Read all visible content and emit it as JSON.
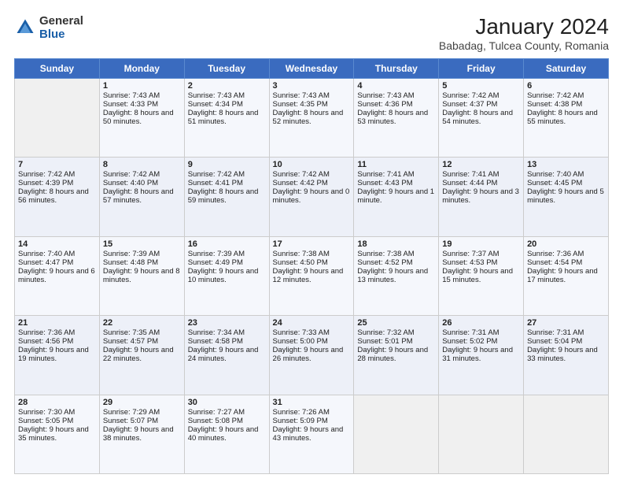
{
  "header": {
    "logo": {
      "general": "General",
      "blue": "Blue"
    },
    "title": "January 2024",
    "subtitle": "Babadag, Tulcea County, Romania"
  },
  "days_of_week": [
    "Sunday",
    "Monday",
    "Tuesday",
    "Wednesday",
    "Thursday",
    "Friday",
    "Saturday"
  ],
  "weeks": [
    [
      {
        "day": "",
        "sunrise": "",
        "sunset": "",
        "daylight": ""
      },
      {
        "day": "1",
        "sunrise": "Sunrise: 7:43 AM",
        "sunset": "Sunset: 4:33 PM",
        "daylight": "Daylight: 8 hours and 50 minutes."
      },
      {
        "day": "2",
        "sunrise": "Sunrise: 7:43 AM",
        "sunset": "Sunset: 4:34 PM",
        "daylight": "Daylight: 8 hours and 51 minutes."
      },
      {
        "day": "3",
        "sunrise": "Sunrise: 7:43 AM",
        "sunset": "Sunset: 4:35 PM",
        "daylight": "Daylight: 8 hours and 52 minutes."
      },
      {
        "day": "4",
        "sunrise": "Sunrise: 7:43 AM",
        "sunset": "Sunset: 4:36 PM",
        "daylight": "Daylight: 8 hours and 53 minutes."
      },
      {
        "day": "5",
        "sunrise": "Sunrise: 7:42 AM",
        "sunset": "Sunset: 4:37 PM",
        "daylight": "Daylight: 8 hours and 54 minutes."
      },
      {
        "day": "6",
        "sunrise": "Sunrise: 7:42 AM",
        "sunset": "Sunset: 4:38 PM",
        "daylight": "Daylight: 8 hours and 55 minutes."
      }
    ],
    [
      {
        "day": "7",
        "sunrise": "Sunrise: 7:42 AM",
        "sunset": "Sunset: 4:39 PM",
        "daylight": "Daylight: 8 hours and 56 minutes."
      },
      {
        "day": "8",
        "sunrise": "Sunrise: 7:42 AM",
        "sunset": "Sunset: 4:40 PM",
        "daylight": "Daylight: 8 hours and 57 minutes."
      },
      {
        "day": "9",
        "sunrise": "Sunrise: 7:42 AM",
        "sunset": "Sunset: 4:41 PM",
        "daylight": "Daylight: 8 hours and 59 minutes."
      },
      {
        "day": "10",
        "sunrise": "Sunrise: 7:42 AM",
        "sunset": "Sunset: 4:42 PM",
        "daylight": "Daylight: 9 hours and 0 minutes."
      },
      {
        "day": "11",
        "sunrise": "Sunrise: 7:41 AM",
        "sunset": "Sunset: 4:43 PM",
        "daylight": "Daylight: 9 hours and 1 minute."
      },
      {
        "day": "12",
        "sunrise": "Sunrise: 7:41 AM",
        "sunset": "Sunset: 4:44 PM",
        "daylight": "Daylight: 9 hours and 3 minutes."
      },
      {
        "day": "13",
        "sunrise": "Sunrise: 7:40 AM",
        "sunset": "Sunset: 4:45 PM",
        "daylight": "Daylight: 9 hours and 5 minutes."
      }
    ],
    [
      {
        "day": "14",
        "sunrise": "Sunrise: 7:40 AM",
        "sunset": "Sunset: 4:47 PM",
        "daylight": "Daylight: 9 hours and 6 minutes."
      },
      {
        "day": "15",
        "sunrise": "Sunrise: 7:39 AM",
        "sunset": "Sunset: 4:48 PM",
        "daylight": "Daylight: 9 hours and 8 minutes."
      },
      {
        "day": "16",
        "sunrise": "Sunrise: 7:39 AM",
        "sunset": "Sunset: 4:49 PM",
        "daylight": "Daylight: 9 hours and 10 minutes."
      },
      {
        "day": "17",
        "sunrise": "Sunrise: 7:38 AM",
        "sunset": "Sunset: 4:50 PM",
        "daylight": "Daylight: 9 hours and 12 minutes."
      },
      {
        "day": "18",
        "sunrise": "Sunrise: 7:38 AM",
        "sunset": "Sunset: 4:52 PM",
        "daylight": "Daylight: 9 hours and 13 minutes."
      },
      {
        "day": "19",
        "sunrise": "Sunrise: 7:37 AM",
        "sunset": "Sunset: 4:53 PM",
        "daylight": "Daylight: 9 hours and 15 minutes."
      },
      {
        "day": "20",
        "sunrise": "Sunrise: 7:36 AM",
        "sunset": "Sunset: 4:54 PM",
        "daylight": "Daylight: 9 hours and 17 minutes."
      }
    ],
    [
      {
        "day": "21",
        "sunrise": "Sunrise: 7:36 AM",
        "sunset": "Sunset: 4:56 PM",
        "daylight": "Daylight: 9 hours and 19 minutes."
      },
      {
        "day": "22",
        "sunrise": "Sunrise: 7:35 AM",
        "sunset": "Sunset: 4:57 PM",
        "daylight": "Daylight: 9 hours and 22 minutes."
      },
      {
        "day": "23",
        "sunrise": "Sunrise: 7:34 AM",
        "sunset": "Sunset: 4:58 PM",
        "daylight": "Daylight: 9 hours and 24 minutes."
      },
      {
        "day": "24",
        "sunrise": "Sunrise: 7:33 AM",
        "sunset": "Sunset: 5:00 PM",
        "daylight": "Daylight: 9 hours and 26 minutes."
      },
      {
        "day": "25",
        "sunrise": "Sunrise: 7:32 AM",
        "sunset": "Sunset: 5:01 PM",
        "daylight": "Daylight: 9 hours and 28 minutes."
      },
      {
        "day": "26",
        "sunrise": "Sunrise: 7:31 AM",
        "sunset": "Sunset: 5:02 PM",
        "daylight": "Daylight: 9 hours and 31 minutes."
      },
      {
        "day": "27",
        "sunrise": "Sunrise: 7:31 AM",
        "sunset": "Sunset: 5:04 PM",
        "daylight": "Daylight: 9 hours and 33 minutes."
      }
    ],
    [
      {
        "day": "28",
        "sunrise": "Sunrise: 7:30 AM",
        "sunset": "Sunset: 5:05 PM",
        "daylight": "Daylight: 9 hours and 35 minutes."
      },
      {
        "day": "29",
        "sunrise": "Sunrise: 7:29 AM",
        "sunset": "Sunset: 5:07 PM",
        "daylight": "Daylight: 9 hours and 38 minutes."
      },
      {
        "day": "30",
        "sunrise": "Sunrise: 7:27 AM",
        "sunset": "Sunset: 5:08 PM",
        "daylight": "Daylight: 9 hours and 40 minutes."
      },
      {
        "day": "31",
        "sunrise": "Sunrise: 7:26 AM",
        "sunset": "Sunset: 5:09 PM",
        "daylight": "Daylight: 9 hours and 43 minutes."
      },
      {
        "day": "",
        "sunrise": "",
        "sunset": "",
        "daylight": ""
      },
      {
        "day": "",
        "sunrise": "",
        "sunset": "",
        "daylight": ""
      },
      {
        "day": "",
        "sunrise": "",
        "sunset": "",
        "daylight": ""
      }
    ]
  ]
}
